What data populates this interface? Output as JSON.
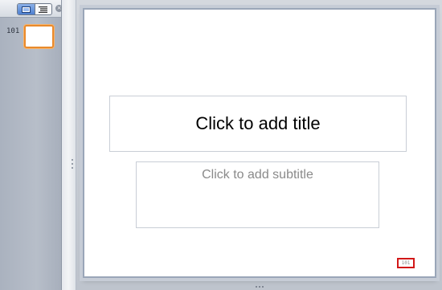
{
  "thumbnail_pane": {
    "view_modes": [
      {
        "name": "slides-view",
        "icon": "slides-view-icon",
        "active": true
      },
      {
        "name": "outline-view",
        "icon": "outline-view-icon",
        "active": false
      }
    ],
    "close_icon": "close-icon",
    "slides": [
      {
        "number": "101",
        "selected": true
      }
    ]
  },
  "slide": {
    "title_placeholder": "Click to add title",
    "subtitle_placeholder": "Click to add subtitle",
    "page_number": "101"
  },
  "colors": {
    "selection_accent": "#e98a2c",
    "page_number_highlight": "#d21818"
  }
}
